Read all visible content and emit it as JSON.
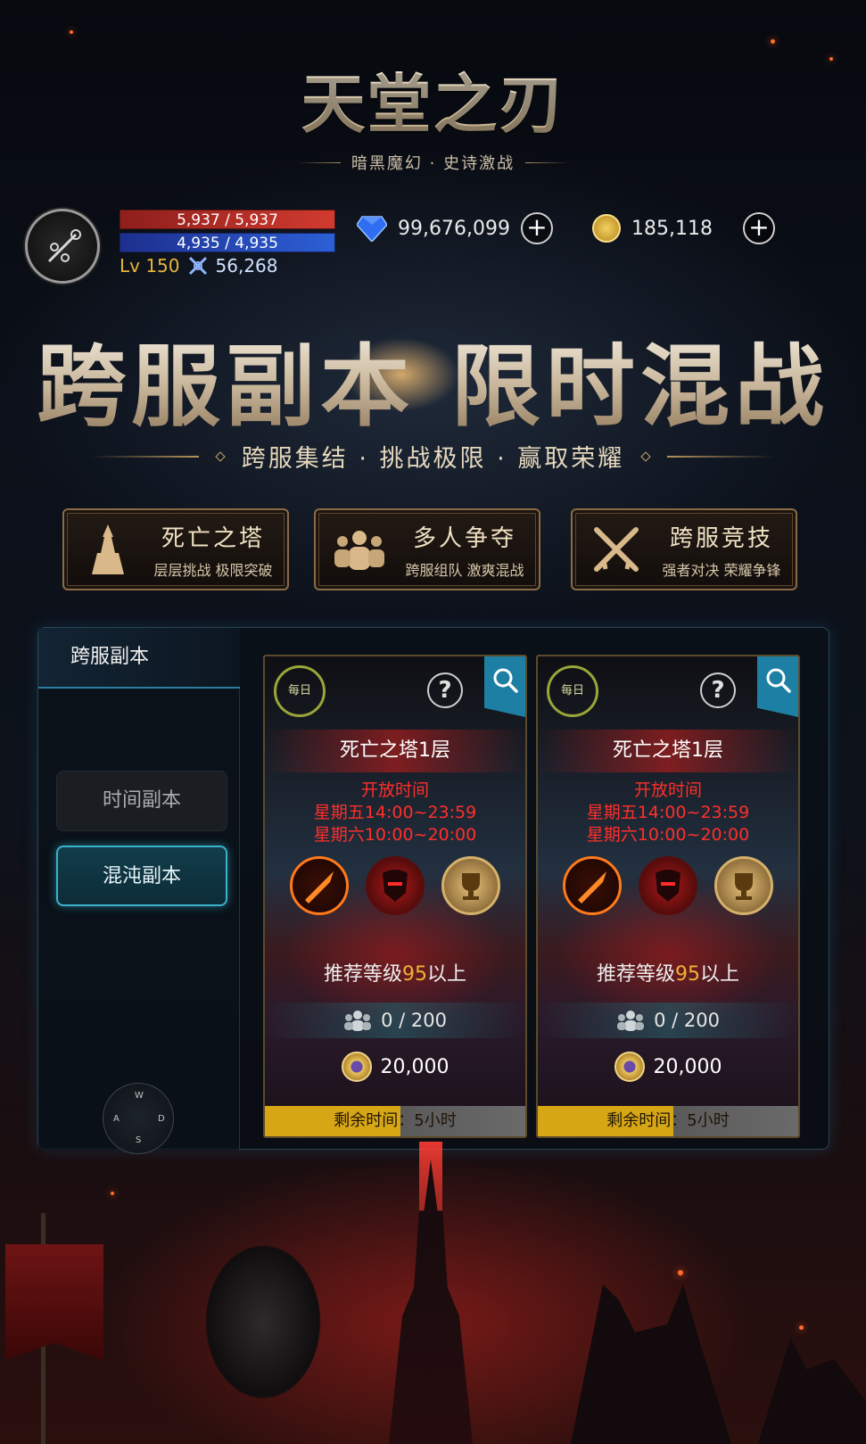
{
  "logo": {
    "title": "天堂之刃",
    "subtitle": "暗黑魔幻 · 史诗激战"
  },
  "player": {
    "hp": "5,937 / 5,937",
    "mp": "4,935 / 4,935",
    "level": "Lv 150",
    "power": "56,268"
  },
  "currency": {
    "gems": "99,676,099",
    "gold": "185,118",
    "add_symbol": "+"
  },
  "banner": {
    "title": "跨服副本 限时混战",
    "tagline": "跨服集结 · 挑战极限 · 赢取荣耀"
  },
  "features": [
    {
      "title": "死亡之塔",
      "subtitle": "层层挑战 极限突破"
    },
    {
      "title": "多人争夺",
      "subtitle": "跨服组队 激爽混战"
    },
    {
      "title": "跨服竞技",
      "subtitle": "强者对决 荣耀争锋"
    }
  ],
  "panel": {
    "title": "跨服副本",
    "tabs": [
      {
        "label": "时间副本"
      },
      {
        "label": "混沌副本"
      }
    ],
    "joystick": {
      "w": "W",
      "a": "A",
      "s": "S",
      "d": "D"
    }
  },
  "cards": [
    {
      "badge": "每日",
      "help": "?",
      "title": "死亡之塔1层",
      "open_label": "开放时间",
      "open_line1": "星期五14:00~23:59",
      "open_line2": "星期六10:00~20:00",
      "rec_prefix": "推荐等级",
      "rec_level": "95",
      "rec_suffix": "以上",
      "slots": "0 / 200",
      "cost": "20,000",
      "time_left": "剩余时间：5小时"
    },
    {
      "badge": "每日",
      "help": "?",
      "title": "死亡之塔1层",
      "open_label": "开放时间",
      "open_line1": "星期五14:00~23:59",
      "open_line2": "星期六10:00~20:00",
      "rec_prefix": "推荐等级",
      "rec_level": "95",
      "rec_suffix": "以上",
      "slots": "0 / 200",
      "cost": "20,000",
      "time_left": "剩余时间：5小时"
    }
  ],
  "colors": {
    "accent_teal": "#3bb2cc",
    "gold": "#f2b133",
    "red_text": "#ff2f2a",
    "hp_red": "#d23b2f",
    "mp_blue": "#2c5fd6"
  }
}
